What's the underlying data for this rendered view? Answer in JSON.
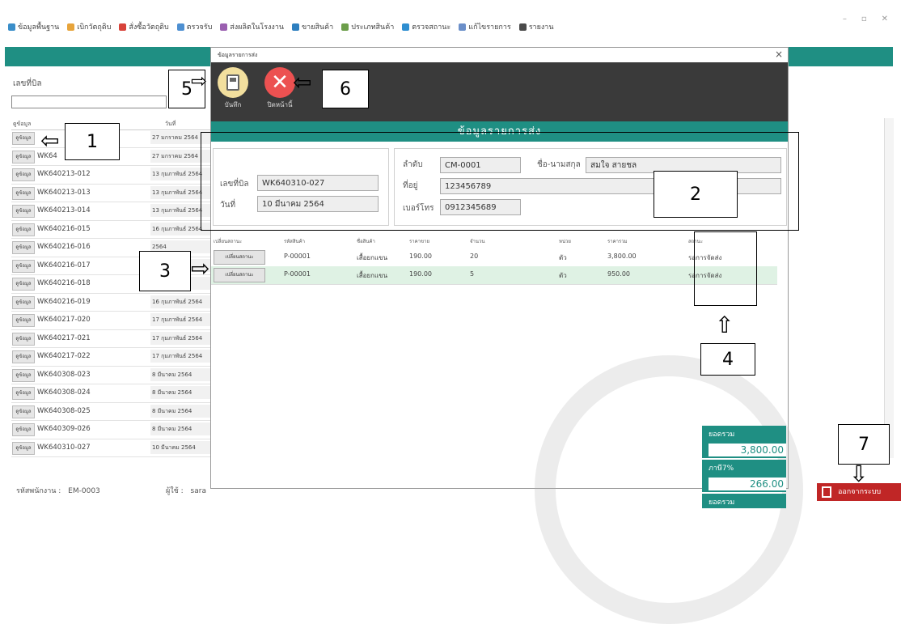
{
  "menu": [
    {
      "label": "ข้อมูลพื้นฐาน",
      "color": "#3a8ec9"
    },
    {
      "label": "เบิกวัตถุดิบ",
      "color": "#e7a43b"
    },
    {
      "label": "สั่งซื้อวัตถุดิบ",
      "color": "#d8433a"
    },
    {
      "label": "ตรวจรับ",
      "color": "#4d8fd1"
    },
    {
      "label": "ส่งผลิตในโรงงาน",
      "color": "#9a5fb0"
    },
    {
      "label": "ขายสินค้า",
      "color": "#2e7fbf"
    },
    {
      "label": "ประเภทสินค้า",
      "color": "#6c9e4a"
    },
    {
      "label": "ตรวจสถานะ",
      "color": "#2f8ed0"
    },
    {
      "label": "แก้ไขรายการ",
      "color": "#6b8fc9"
    },
    {
      "label": "รายงาน",
      "color": "#4a4a4a"
    }
  ],
  "left": {
    "bill_label": "เลขที่บิล",
    "col_detail": "ดูข้อมูล",
    "col_date": "วันที่",
    "row_button": "ดูข้อมูล",
    "rows": [
      {
        "id": "",
        "date": "27 มกราคม 2564"
      },
      {
        "id": "WK64",
        "date": "27 มกราคม 2564"
      },
      {
        "id": "WK640213-012",
        "date": "13 กุมภาพันธ์ 2564"
      },
      {
        "id": "WK640213-013",
        "date": "13 กุมภาพันธ์ 2564"
      },
      {
        "id": "WK640213-014",
        "date": "13 กุมภาพันธ์ 2564"
      },
      {
        "id": "WK640216-015",
        "date": "16 กุมภาพันธ์ 2564"
      },
      {
        "id": "WK640216-016",
        "date": "2564"
      },
      {
        "id": "WK640216-017",
        "date": ""
      },
      {
        "id": "WK640216-018",
        "date": "2564"
      },
      {
        "id": "WK640216-019",
        "date": "16 กุมภาพันธ์ 2564"
      },
      {
        "id": "WK640217-020",
        "date": "17 กุมภาพันธ์ 2564"
      },
      {
        "id": "WK640217-021",
        "date": "17 กุมภาพันธ์ 2564"
      },
      {
        "id": "WK640217-022",
        "date": "17 กุมภาพันธ์ 2564"
      },
      {
        "id": "WK640308-023",
        "date": "8 มีนาคม 2564"
      },
      {
        "id": "WK640308-024",
        "date": "8 มีนาคม 2564"
      },
      {
        "id": "WK640308-025",
        "date": "8 มีนาคม 2564"
      },
      {
        "id": "WK640309-026",
        "date": "8 มีนาคม 2564"
      },
      {
        "id": "WK640310-027",
        "date": "10 มีนาคม 2564"
      }
    ],
    "employee_label": "รหัสพนักงาน :",
    "employee_id": "EM-0003",
    "user_label": "ผู้ใช้ :",
    "user_name": "sara"
  },
  "modal": {
    "title": "ข้อมูลรายการส่ง",
    "save_label": "บันทึก",
    "close_label": "ปิดหน้านี้",
    "section_title": "ข้อมูลรายการส่ง",
    "bill_label": "เลขที่บิล",
    "bill_no": "WK640310-027",
    "date_label": "วันที่",
    "date_value": "10 มีนาคม 2564",
    "seq_label": "ลำดับ",
    "customer_id": "CM-0001",
    "name_label": "ชื่อ-นามสกุล",
    "customer_name": "สมใจ สายชล",
    "address_label": "ที่อยู่",
    "address": "123456789",
    "phone_label": "เบอร์โทร",
    "phone": "0912345689",
    "table": {
      "headers": [
        "เปลี่ยนสถานะ",
        "รหัสสินค้า",
        "ชื่อสินค้า",
        "ราคาขาย",
        "จำนวน",
        "หน่วย",
        "ราคารวม",
        "สถานะ"
      ],
      "rows": [
        {
          "btn": "เปลี่ยนสถานะ",
          "code": "P-00001",
          "name": "เสื้อยกแขน",
          "price": "190.00",
          "qty": "20",
          "unit": "ตัว",
          "total": "3,800.00",
          "status": "รอการจัดส่ง"
        },
        {
          "btn": "เปลี่ยนสถานะ",
          "code": "P-00001",
          "name": "เสื้อยกแขน",
          "price": "190.00",
          "qty": "5",
          "unit": "ตัว",
          "total": "950.00",
          "status": "รอการจัดส่ง"
        }
      ]
    }
  },
  "totals": {
    "sum_label": "ยอดรวม",
    "sum_value": "3,800.00",
    "vat_label": "ภาษี7%",
    "vat_value": "266.00",
    "net_label": "ยอดรวม"
  },
  "exit_label": "ออกจากระบบ",
  "callouts": [
    "1",
    "2",
    "3",
    "4",
    "5",
    "6",
    "7"
  ]
}
